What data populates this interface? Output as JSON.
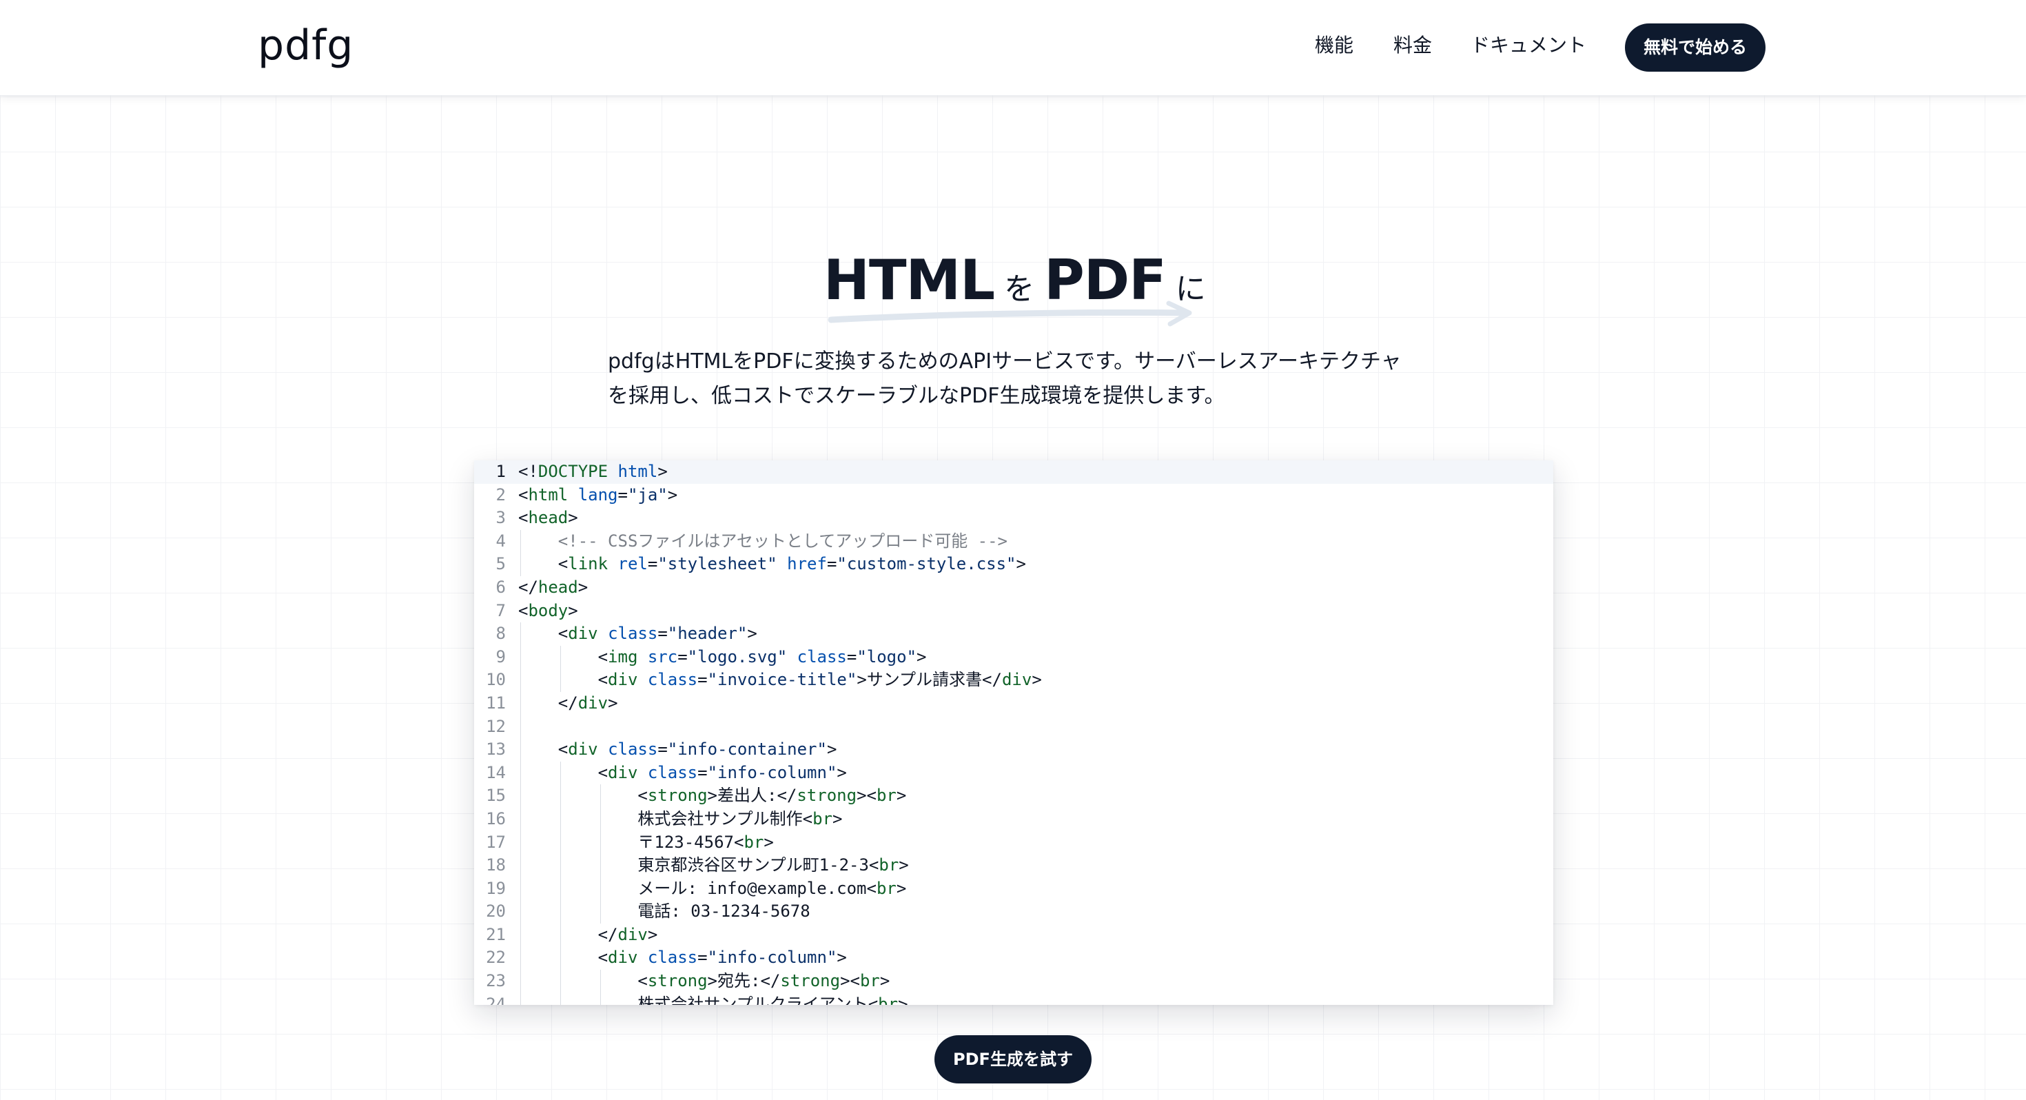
{
  "nav": {
    "logo": "pdfg",
    "links": [
      "機能",
      "料金",
      "ドキュメント"
    ],
    "cta_label": "無料で始める"
  },
  "hero": {
    "title_parts": [
      {
        "text": "HTML",
        "size": "big"
      },
      {
        "text": " を ",
        "size": "small"
      },
      {
        "text": "PDF",
        "size": "big"
      },
      {
        "text": " に",
        "size": "small"
      }
    ],
    "subtitle_lines": [
      "pdfgはHTMLをPDFに変換するためのAPIサービスです。サーバーレスアーキテクチャ",
      "を採用し、低コストでスケーラブルなPDF生成環境を提供します。"
    ]
  },
  "editor": {
    "active_line": 1,
    "lines": [
      {
        "n": "1",
        "indent": 0,
        "tokens": [
          [
            "p",
            "<!"
          ],
          [
            "tag",
            "DOCTYPE"
          ],
          [
            "p",
            " "
          ],
          [
            "attr",
            "html"
          ],
          [
            "p",
            ">"
          ]
        ]
      },
      {
        "n": "2",
        "indent": 0,
        "tokens": [
          [
            "p",
            "<"
          ],
          [
            "tag",
            "html"
          ],
          [
            "p",
            " "
          ],
          [
            "attr",
            "lang"
          ],
          [
            "p",
            "="
          ],
          [
            "str",
            "\"ja\""
          ],
          [
            "p",
            ">"
          ]
        ]
      },
      {
        "n": "3",
        "indent": 0,
        "tokens": [
          [
            "p",
            "<"
          ],
          [
            "tag",
            "head"
          ],
          [
            "p",
            ">"
          ]
        ]
      },
      {
        "n": "4",
        "indent": 1,
        "tokens": [
          [
            "com",
            "<!-- CSSファイルはアセットとしてアップロード可能 -->"
          ]
        ]
      },
      {
        "n": "5",
        "indent": 1,
        "tokens": [
          [
            "p",
            "<"
          ],
          [
            "tag",
            "link"
          ],
          [
            "p",
            " "
          ],
          [
            "attr",
            "rel"
          ],
          [
            "p",
            "="
          ],
          [
            "str",
            "\"stylesheet\""
          ],
          [
            "p",
            " "
          ],
          [
            "attr",
            "href"
          ],
          [
            "p",
            "="
          ],
          [
            "str",
            "\"custom-style.css\""
          ],
          [
            "p",
            ">"
          ]
        ]
      },
      {
        "n": "6",
        "indent": 0,
        "tokens": [
          [
            "p",
            "</"
          ],
          [
            "tag",
            "head"
          ],
          [
            "p",
            ">"
          ]
        ]
      },
      {
        "n": "7",
        "indent": 0,
        "tokens": [
          [
            "p",
            "<"
          ],
          [
            "tag",
            "body"
          ],
          [
            "p",
            ">"
          ]
        ]
      },
      {
        "n": "8",
        "indent": 1,
        "tokens": [
          [
            "p",
            "<"
          ],
          [
            "tag",
            "div"
          ],
          [
            "p",
            " "
          ],
          [
            "attr",
            "class"
          ],
          [
            "p",
            "="
          ],
          [
            "str",
            "\"header\""
          ],
          [
            "p",
            ">"
          ]
        ]
      },
      {
        "n": "9",
        "indent": 2,
        "tokens": [
          [
            "p",
            "<"
          ],
          [
            "tag",
            "img"
          ],
          [
            "p",
            " "
          ],
          [
            "attr",
            "src"
          ],
          [
            "p",
            "="
          ],
          [
            "str",
            "\"logo.svg\""
          ],
          [
            "p",
            " "
          ],
          [
            "attr",
            "class"
          ],
          [
            "p",
            "="
          ],
          [
            "str",
            "\"logo\""
          ],
          [
            "p",
            ">"
          ]
        ]
      },
      {
        "n": "10",
        "indent": 2,
        "tokens": [
          [
            "p",
            "<"
          ],
          [
            "tag",
            "div"
          ],
          [
            "p",
            " "
          ],
          [
            "attr",
            "class"
          ],
          [
            "p",
            "="
          ],
          [
            "str",
            "\"invoice-title\""
          ],
          [
            "p",
            ">"
          ],
          [
            "txt",
            "サンプル請求書"
          ],
          [
            "p",
            "</"
          ],
          [
            "tag",
            "div"
          ],
          [
            "p",
            ">"
          ]
        ]
      },
      {
        "n": "11",
        "indent": 1,
        "tokens": [
          [
            "p",
            "</"
          ],
          [
            "tag",
            "div"
          ],
          [
            "p",
            ">"
          ]
        ]
      },
      {
        "n": "12",
        "indent": 1,
        "tokens": []
      },
      {
        "n": "13",
        "indent": 1,
        "tokens": [
          [
            "p",
            "<"
          ],
          [
            "tag",
            "div"
          ],
          [
            "p",
            " "
          ],
          [
            "attr",
            "class"
          ],
          [
            "p",
            "="
          ],
          [
            "str",
            "\"info-container\""
          ],
          [
            "p",
            ">"
          ]
        ]
      },
      {
        "n": "14",
        "indent": 2,
        "tokens": [
          [
            "p",
            "<"
          ],
          [
            "tag",
            "div"
          ],
          [
            "p",
            " "
          ],
          [
            "attr",
            "class"
          ],
          [
            "p",
            "="
          ],
          [
            "str",
            "\"info-column\""
          ],
          [
            "p",
            ">"
          ]
        ]
      },
      {
        "n": "15",
        "indent": 3,
        "tokens": [
          [
            "p",
            "<"
          ],
          [
            "tag",
            "strong"
          ],
          [
            "p",
            ">"
          ],
          [
            "txt",
            "差出人:"
          ],
          [
            "p",
            "</"
          ],
          [
            "tag",
            "strong"
          ],
          [
            "p",
            "><"
          ],
          [
            "tag",
            "br"
          ],
          [
            "p",
            ">"
          ]
        ]
      },
      {
        "n": "16",
        "indent": 3,
        "tokens": [
          [
            "txt",
            "株式会社サンプル制作"
          ],
          [
            "p",
            "<"
          ],
          [
            "tag",
            "br"
          ],
          [
            "p",
            ">"
          ]
        ]
      },
      {
        "n": "17",
        "indent": 3,
        "tokens": [
          [
            "txt",
            "〒123-4567"
          ],
          [
            "p",
            "<"
          ],
          [
            "tag",
            "br"
          ],
          [
            "p",
            ">"
          ]
        ]
      },
      {
        "n": "18",
        "indent": 3,
        "tokens": [
          [
            "txt",
            "東京都渋谷区サンプル町1-2-3"
          ],
          [
            "p",
            "<"
          ],
          [
            "tag",
            "br"
          ],
          [
            "p",
            ">"
          ]
        ]
      },
      {
        "n": "19",
        "indent": 3,
        "tokens": [
          [
            "txt",
            "メール: info@example.com"
          ],
          [
            "p",
            "<"
          ],
          [
            "tag",
            "br"
          ],
          [
            "p",
            ">"
          ]
        ]
      },
      {
        "n": "20",
        "indent": 3,
        "tokens": [
          [
            "txt",
            "電話: 03-1234-5678"
          ]
        ]
      },
      {
        "n": "21",
        "indent": 2,
        "tokens": [
          [
            "p",
            "</"
          ],
          [
            "tag",
            "div"
          ],
          [
            "p",
            ">"
          ]
        ]
      },
      {
        "n": "22",
        "indent": 2,
        "tokens": [
          [
            "p",
            "<"
          ],
          [
            "tag",
            "div"
          ],
          [
            "p",
            " "
          ],
          [
            "attr",
            "class"
          ],
          [
            "p",
            "="
          ],
          [
            "str",
            "\"info-column\""
          ],
          [
            "p",
            ">"
          ]
        ]
      },
      {
        "n": "23",
        "indent": 3,
        "tokens": [
          [
            "p",
            "<"
          ],
          [
            "tag",
            "strong"
          ],
          [
            "p",
            ">"
          ],
          [
            "txt",
            "宛先:"
          ],
          [
            "p",
            "</"
          ],
          [
            "tag",
            "strong"
          ],
          [
            "p",
            "><"
          ],
          [
            "tag",
            "br"
          ],
          [
            "p",
            ">"
          ]
        ]
      },
      {
        "n": "24",
        "indent": 3,
        "tokens": [
          [
            "txt",
            "株式会社サンプルクライアント"
          ],
          [
            "p",
            "<"
          ],
          [
            "tag",
            "br"
          ],
          [
            "p",
            ">"
          ]
        ]
      }
    ]
  },
  "try_button_label": "PDF生成を試す",
  "colors": {
    "primary_dark": "#0e1a2e",
    "tag": "#116329",
    "attribute": "#0550ae",
    "string": "#0a3069",
    "comment": "#7a7f87"
  }
}
